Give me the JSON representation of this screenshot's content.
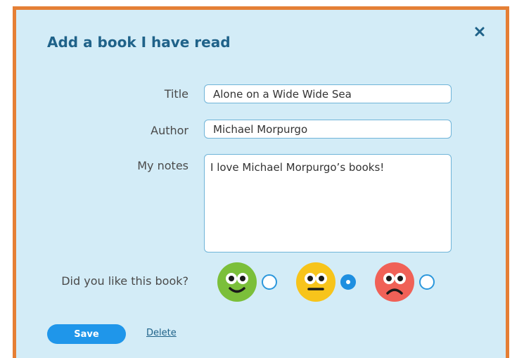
{
  "dialog": {
    "title": "Add a book I have read",
    "close_icon": "close-icon"
  },
  "form": {
    "title_label": "Title",
    "title_value": "Alone on a Wide Wide Sea",
    "author_label": "Author",
    "author_value": "Michael Morpurgo",
    "notes_label": "My notes",
    "notes_value": "I love Michael Morpurgo’s books!",
    "rating_question": "Did you like this book?",
    "rating_options": [
      {
        "icon": "happy-face-icon",
        "color": "#7bbf3a",
        "selected": false
      },
      {
        "icon": "neutral-face-icon",
        "color": "#f7c41b",
        "selected": true
      },
      {
        "icon": "sad-face-icon",
        "color": "#f06157",
        "selected": false
      }
    ]
  },
  "actions": {
    "save_label": "Save",
    "delete_label": "Delete"
  },
  "colors": {
    "frame_border": "#e57f35",
    "dialog_background": "#d3ecf7",
    "heading": "#1f6289",
    "primary_button": "#1f96ea"
  }
}
